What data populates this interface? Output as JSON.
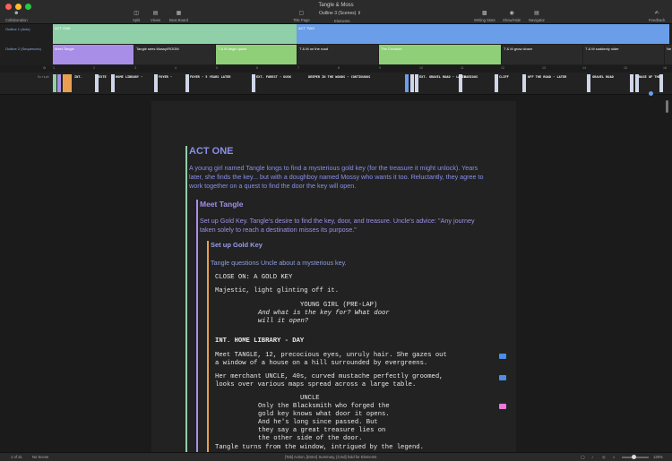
{
  "window": {
    "title": "Tangle & Moss"
  },
  "toolbar": {
    "collaboration": "Collaboration",
    "split": "Split",
    "views": "Views",
    "beat_board": "Beat Board",
    "title_page": "Title Page",
    "outline_select": "Outline 3 (Scenes)",
    "elements": "Elements",
    "writing_stats": "Writing Stats",
    "show_hide": "Show/Hide",
    "navigator": "Navigator",
    "feedback": "Feedback"
  },
  "outline1": {
    "label": "Outline 1 (Acts)",
    "blocks": [
      {
        "label": "ACT ONE",
        "color": "#8fd0a8"
      },
      {
        "label": "ACT TWO",
        "color": "#6b9ee8"
      }
    ]
  },
  "outline2": {
    "label": "Outline 2 (Sequences)",
    "blocks": [
      {
        "label": "Meet Tangle",
        "color": "#a98ee8"
      },
      {
        "label": "Tangle sees Mossy/ROOM",
        "color": "#2a2a2a"
      },
      {
        "label": "T & M begin quest",
        "color": "#8fcf78"
      },
      {
        "label": "T & M on the road",
        "color": "#2a2a2a"
      },
      {
        "label": "The Creature",
        "color": "#8fcf78"
      },
      {
        "label": "T & M grow closer",
        "color": "#2a2a2a"
      },
      {
        "label": "T & M suddenly older",
        "color": "#2a2a2a"
      },
      {
        "label": "Ne",
        "color": "#2a2a2a"
      }
    ]
  },
  "ruler": [
    "1",
    "2",
    "3",
    "4",
    "5",
    "6",
    "7",
    "8",
    "9",
    "10",
    "11",
    "12",
    "13",
    "14",
    "15",
    "16"
  ],
  "strip": {
    "label": "Script",
    "scenes": [
      "INT.",
      "EXTE",
      "HOME LIBRARY -",
      "FOYER -",
      "FOYER - 5 YEARS LATER",
      "EXT. FOREST - DUSK",
      "DEEPER IN THE WOODS - CONTINUOUS",
      "EXT. GRAVEL ROAD - LATER",
      "VARIOUS",
      "CLIFF",
      "OFF THE ROAD - LATER",
      "GRAVEL ROAD",
      "BASE OF THE"
    ]
  },
  "script": {
    "act_title": "ACT ONE",
    "act_desc": "A young girl named Tangle longs to find a mysterious gold key (for the treasure it might unlock). Years later, she finds the key... but with a doughboy named Mossy who wants it too. Reluctantly, they agree to work together on a quest to find the door the key will open.",
    "seq_title": "Meet Tangle",
    "seq_desc": "Set up Gold Key. Tangle's desire to find the key, door, and treasure. Uncle's advice: \"Any journey taken solely to reach a destination misses its purpose.\"",
    "scene_title": "Set up Gold Key",
    "scene_desc": "Tangle questions Uncle about a mysterious key.",
    "lines": [
      "CLOSE ON: A GOLD KEY",
      "Majestic, light glinting off it.",
      "YOUNG GIRL (PRE-LAP)",
      "And what is the key for? What door",
      "will it open?",
      "INT. HOME LIBRARY - DAY",
      "Meet TANGLE, 12, precocious eyes, unruly hair. She gazes out",
      "a window of a house on a hill surrounded by evergreens.",
      "Her merchant UNCLE, 40s, curved mustache perfectly groomed,",
      "looks over various maps spread across a large table.",
      "UNCLE",
      "Only the Blacksmith who forged the",
      "gold key knows what door it opens.",
      "And he's long since passed. But",
      "they say a great treasure lies on",
      "the other side of the door.",
      "Tangle turns from the window, intrigued by the legend."
    ]
  },
  "status": {
    "page": "1 of 31",
    "revision": "No Scene",
    "hint": "[Tab] Action, [Enter] Summary, [Cmd] hold for Elements",
    "zoom": "125%"
  },
  "colors": {
    "act": "#8fd0a8",
    "sequence": "#a98ee8",
    "scene": "#e8a050",
    "blue_note": "#4a8ee8",
    "pink_note": "#e87ad8"
  }
}
